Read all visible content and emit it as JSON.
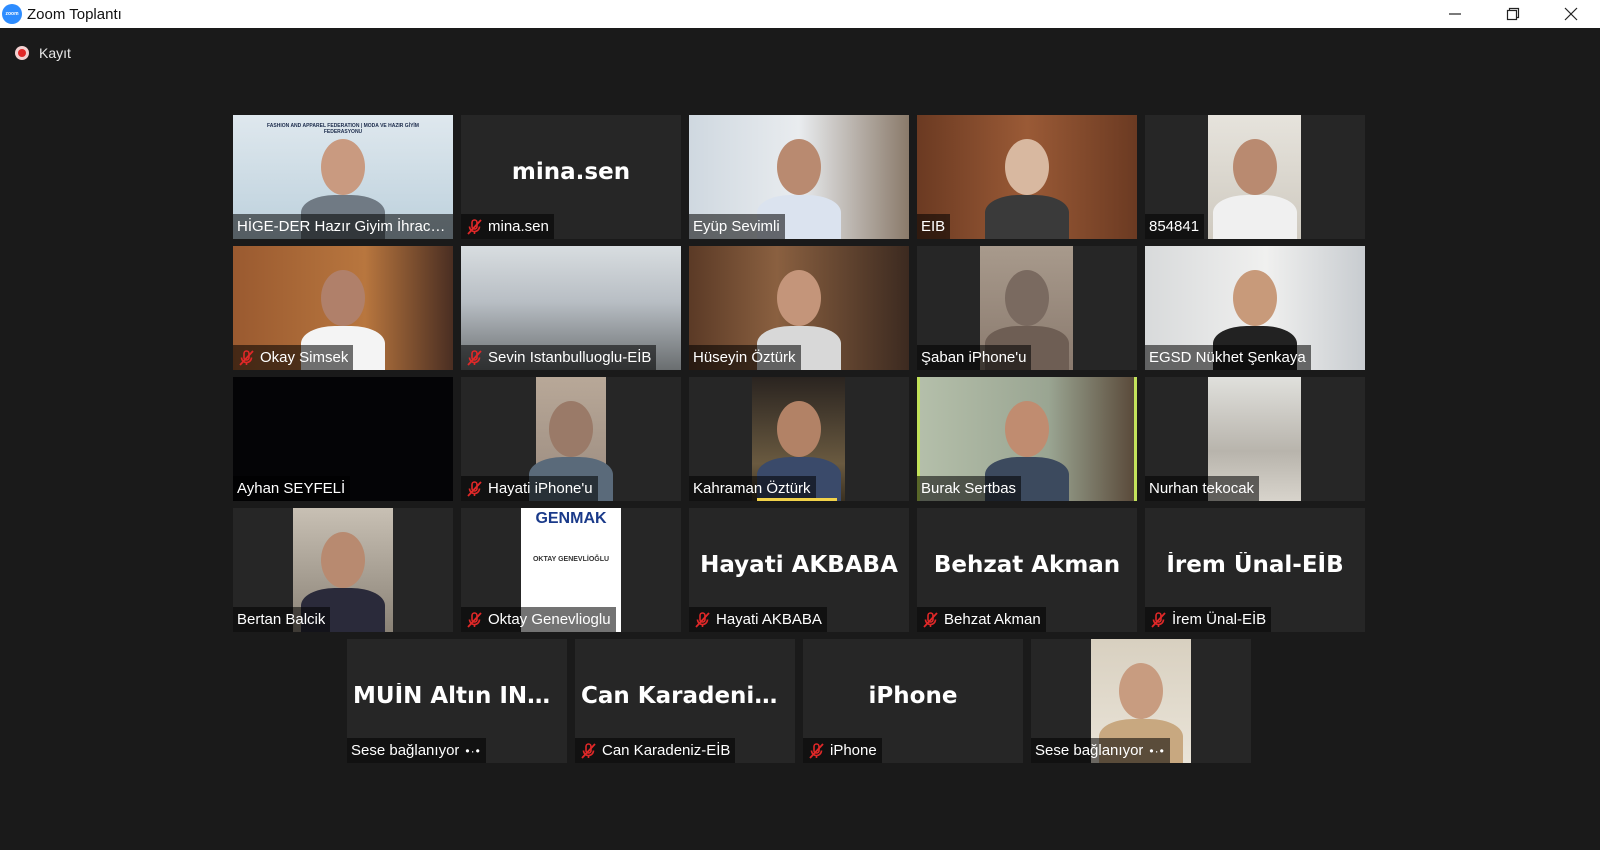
{
  "window": {
    "title": "Zoom Toplantı",
    "icon": "zoom-app-icon",
    "controls": [
      "minimize-icon",
      "restore-icon",
      "close-icon"
    ]
  },
  "recording": {
    "label": "Kayıt",
    "color": "#e02828"
  },
  "active_speaker_color": "#c3e35b",
  "mute_color": "#e02828",
  "participants": [
    {
      "id": "p1",
      "name": "HİGE-DER Hazır Giyim İhracatçıları",
      "muted": false,
      "video": true,
      "logo": "FASHION AND APPAREL FEDERATION | MODA VE HAZIR GİYİM FEDERASYONU"
    },
    {
      "id": "p2",
      "name": "mina.sen",
      "muted": true,
      "video": false,
      "display": "mina.sen"
    },
    {
      "id": "p3",
      "name": "Eyüp Sevimli",
      "muted": false,
      "video": true
    },
    {
      "id": "p4",
      "name": "EIB",
      "muted": false,
      "video": true
    },
    {
      "id": "p5",
      "name": "854841",
      "muted": false,
      "video": true
    },
    {
      "id": "p6",
      "name": "Okay Simsek",
      "muted": true,
      "video": true
    },
    {
      "id": "p7",
      "name": "Sevin Istanbulluoglu-EİB",
      "muted": true,
      "video": true
    },
    {
      "id": "p8",
      "name": "Hüseyin Öztürk",
      "muted": false,
      "video": true
    },
    {
      "id": "p9",
      "name": "Şaban iPhone'u",
      "muted": false,
      "video": true
    },
    {
      "id": "p10",
      "name": "EGSD Nükhet Şenkaya",
      "muted": false,
      "video": true
    },
    {
      "id": "p11",
      "name": "Ayhan SEYFELİ",
      "muted": false,
      "video": true
    },
    {
      "id": "p12",
      "name": "Hayati iPhone'u",
      "muted": true,
      "video": true
    },
    {
      "id": "p13",
      "name": "Kahraman Öztürk",
      "muted": false,
      "video": true
    },
    {
      "id": "p14",
      "name": "Burak Sertbas",
      "muted": false,
      "video": true,
      "active": true
    },
    {
      "id": "p15",
      "name": "Nurhan tekocak",
      "muted": false,
      "video": true
    },
    {
      "id": "p16",
      "name": "Bertan Balcik",
      "muted": false,
      "video": true
    },
    {
      "id": "p17",
      "name": "Oktay Genevlioglu",
      "muted": true,
      "video": true,
      "logo": "GENMAK",
      "logo_sub": "OKTAY GENEVLİOĞLU"
    },
    {
      "id": "p18",
      "name": "Hayati AKBABA",
      "muted": true,
      "video": false,
      "display": "Hayati AKBABA"
    },
    {
      "id": "p19",
      "name": "Behzat Akman",
      "muted": true,
      "video": false,
      "display": "Behzat Akman"
    },
    {
      "id": "p20",
      "name": "İrem Ünal-EİB",
      "muted": true,
      "video": false,
      "display": "İrem Ünal-EİB"
    },
    {
      "id": "p21",
      "name": "Sese bağlanıyor",
      "muted": false,
      "video": false,
      "display": "MUİN Altın IND...",
      "connecting": true
    },
    {
      "id": "p22",
      "name": "Can Karadeniz-EİB",
      "muted": true,
      "video": false,
      "display": "Can  Karadeniz-..."
    },
    {
      "id": "p23",
      "name": "iPhone",
      "muted": true,
      "video": false,
      "display": "iPhone"
    },
    {
      "id": "p24",
      "name": "Sese bağlanıyor",
      "muted": false,
      "video": true,
      "connecting": true
    }
  ]
}
